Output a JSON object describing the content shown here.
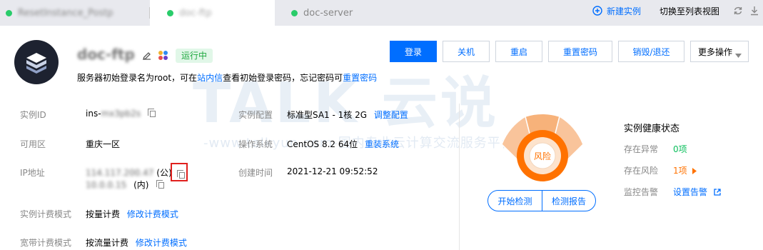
{
  "tabs": [
    {
      "label": "ResetInstance_Postp",
      "active": false,
      "blurred": true
    },
    {
      "label": "doc-ftp",
      "active": true,
      "blurred": true
    },
    {
      "label": "doc-server",
      "active": false,
      "blurred": false
    }
  ],
  "toolbar": {
    "new_instance": "新建实例",
    "switch_list": "切换至列表视图"
  },
  "instance": {
    "name": "doc-ftp",
    "status": "运行中",
    "login_hint_prefix": "服务器初始登录名为root，可在",
    "login_hint_link1": "站内信",
    "login_hint_mid": "查看初始登录密码，忘记密码可",
    "login_hint_link2": "重置密码"
  },
  "actions": {
    "login": "登录",
    "shutdown": "关机",
    "restart": "重启",
    "reset_password": "重置密码",
    "destroy": "销毁/退还",
    "more": "更多操作"
  },
  "fields": {
    "instance_id_label": "实例ID",
    "instance_id_prefix": "ins-",
    "instance_id_suffix": "mx3pb2s",
    "zone_label": "可用区",
    "zone_value": "重庆一区",
    "ip_label": "IP地址",
    "ip_public": "114.117.200.47",
    "ip_public_tag": "(公)",
    "ip_private": "10.0.0.15",
    "ip_private_tag": "(内)",
    "billing_label": "实例计费模式",
    "billing_value": "按量计费",
    "billing_link": "修改计费模式",
    "bandwidth_label": "宽带计费模式",
    "bandwidth_value": "按流量计费",
    "bandwidth_link": "修改计费模式",
    "config_label": "实例配置",
    "config_value": "标准型SA1 - 1核 2G",
    "config_link": "调整配置",
    "os_label": "操作系统",
    "os_value": "CentOS 8.2 64位",
    "os_link": "重装系统",
    "created_label": "创建时间",
    "created_value": "2021-12-21 09:52:52"
  },
  "health": {
    "gauge_label": "风险",
    "start_check": "开始检测",
    "report": "检测报告",
    "title": "实例健康状态",
    "abnormal_label": "存在异常",
    "abnormal_value": "0项",
    "risk_label": "存在风险",
    "risk_value": "1项",
    "alarm_label": "监控告警",
    "alarm_link": "设置告警"
  },
  "watermark": {
    "main": "TALK 云说",
    "sub": "-www.talkyun.com-国内专业云计算交流服务平台-"
  },
  "colors": {
    "brand_blue": "#006eff",
    "running_green": "#1fa83f",
    "risk_orange": "#ff7200",
    "ok_green": "#0abf5b"
  }
}
